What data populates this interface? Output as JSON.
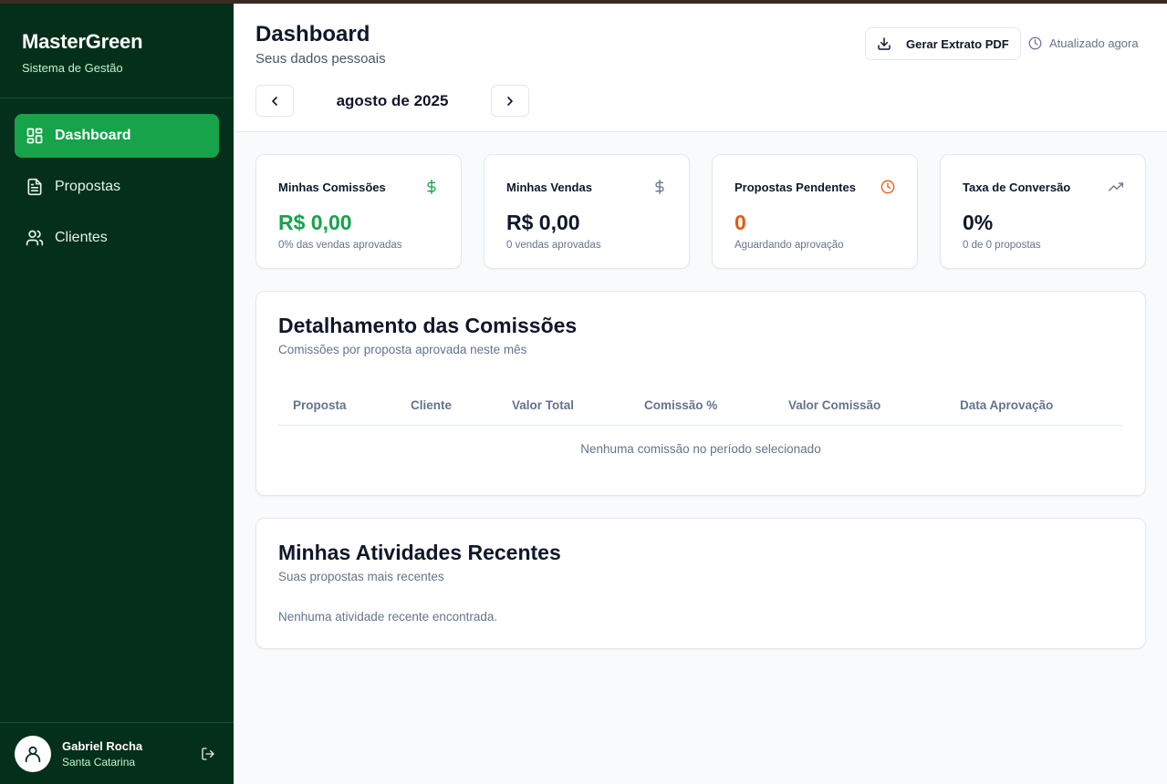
{
  "sidebar": {
    "brand_title": "MasterGreen",
    "brand_subtitle": "Sistema de Gestão",
    "items": [
      {
        "label": "Dashboard",
        "icon": "dashboard-icon",
        "active": true
      },
      {
        "label": "Propostas",
        "icon": "document-icon",
        "active": false
      },
      {
        "label": "Clientes",
        "icon": "users-icon",
        "active": false
      }
    ],
    "user": {
      "name": "Gabriel Rocha",
      "location": "Santa Catarina"
    }
  },
  "header": {
    "title": "Dashboard",
    "subtitle": "Seus dados pessoais",
    "month": "agosto de 2025",
    "pdf_button": "Gerar Extrato PDF",
    "updated": "Atualizado agora"
  },
  "cards": [
    {
      "label": "Minhas Comissões",
      "value": "R$ 0,00",
      "note": "0% das vendas aprovadas",
      "icon": "dollar-icon",
      "color": "#16a34a"
    },
    {
      "label": "Minhas Vendas",
      "value": "R$ 0,00",
      "note": "0 vendas aprovadas",
      "icon": "dollar-icon",
      "color": "#0f172a"
    },
    {
      "label": "Propostas Pendentes",
      "value": "0",
      "note": "Aguardando aprovação",
      "icon": "clock-icon",
      "color": "#ea580c"
    },
    {
      "label": "Taxa de Conversão",
      "value": "0%",
      "note": "0 de 0 propostas",
      "icon": "trending-up-icon",
      "color": "#0f172a"
    }
  ],
  "commissions": {
    "title": "Detalhamento das Comissões",
    "subtitle": "Comissões por proposta aprovada neste mês",
    "columns": [
      "Proposta",
      "Cliente",
      "Valor Total",
      "Comissão %",
      "Valor Comissão",
      "Data Aprovação"
    ],
    "empty": "Nenhuma comissão no período selecionado"
  },
  "activities": {
    "title": "Minhas Atividades Recentes",
    "subtitle": "Suas propostas mais recentes",
    "empty": "Nenhuma atividade recente encontrada."
  },
  "colors": {
    "sidebar_bg": "#042f1a",
    "accent": "#16a34a",
    "pending": "#ea580c"
  }
}
